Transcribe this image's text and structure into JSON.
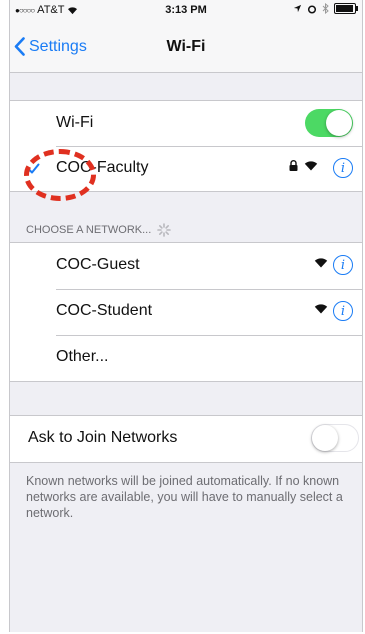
{
  "status_bar": {
    "carrier": "AT&T",
    "time": "3:13 PM"
  },
  "nav": {
    "back_label": "Settings",
    "title": "Wi-Fi"
  },
  "wifi": {
    "label": "Wi-Fi",
    "enabled": true
  },
  "connected": {
    "name": "COC-Faculty",
    "secured": true
  },
  "choose_header": "CHOOSE A NETWORK...",
  "networks": [
    {
      "name": "COC-Guest"
    },
    {
      "name": "COC-Student"
    },
    {
      "name": "Other..."
    }
  ],
  "ask_join": {
    "label": "Ask to Join Networks",
    "enabled": false,
    "footer": "Known networks will be joined automatically. If no known networks are available, you will have to manually select a network."
  },
  "colors": {
    "accent": "#1a7cf5",
    "toggle_on": "#4cd964",
    "annotation": "#e03020"
  }
}
